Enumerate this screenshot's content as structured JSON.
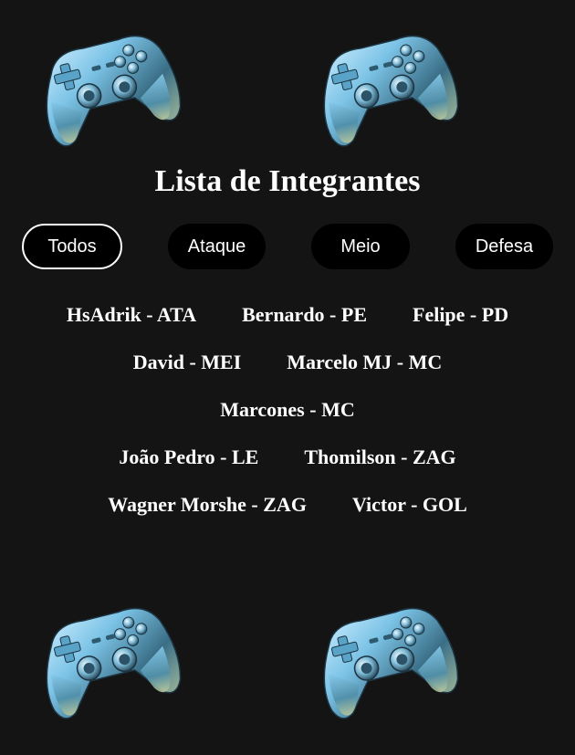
{
  "header": {
    "title": "Lista de Integrantes"
  },
  "decorations": {
    "icon": "gamepad-icon",
    "accent": "#7ec8e8"
  },
  "filters": {
    "active": "Todos",
    "items": [
      {
        "label": "Todos"
      },
      {
        "label": "Ataque"
      },
      {
        "label": "Meio"
      },
      {
        "label": "Defesa"
      }
    ]
  },
  "members": {
    "rows": [
      [
        "HsAdrik - ATA",
        "Bernardo - PE",
        "Felipe - PD"
      ],
      [
        "David - MEI",
        "Marcelo MJ - MC"
      ],
      [
        "Marcones - MC"
      ],
      [
        "João Pedro - LE",
        "Thomilson - ZAG"
      ],
      [
        "Wagner Morshe - ZAG",
        "Victor - GOL"
      ]
    ]
  },
  "colors": {
    "background": "#141414",
    "button_bg": "#000000",
    "text": "#ffffff"
  }
}
